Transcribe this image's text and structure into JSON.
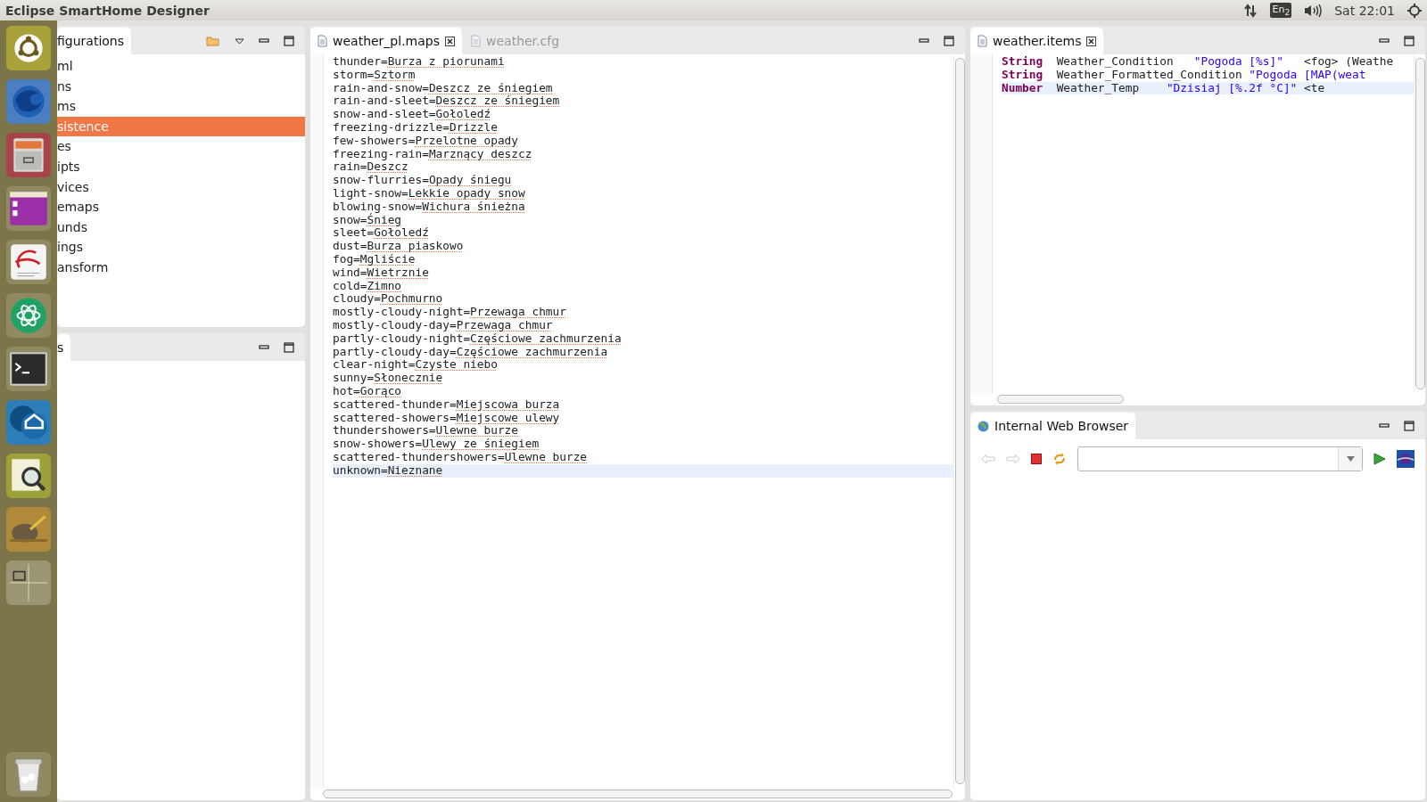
{
  "top_bar": {
    "title": "Eclipse SmartHome Designer",
    "keyboard_layout": "En$_{2}$",
    "clock": "Sat 22:01"
  },
  "launcher": {
    "apps": [
      {
        "kind": "ubuntu"
      },
      {
        "kind": "browser"
      },
      {
        "kind": "files"
      },
      {
        "kind": "purple"
      },
      {
        "kind": "document"
      },
      {
        "kind": "atom"
      },
      {
        "kind": "terminal"
      },
      {
        "kind": "home"
      },
      {
        "kind": "viewer"
      },
      {
        "kind": "paint"
      },
      {
        "kind": "workspaces"
      }
    ],
    "trash": {
      "kind": "trash"
    }
  },
  "explorer": {
    "tab": "figurations",
    "items": [
      {
        "label": "ml",
        "selected": false
      },
      {
        "label": "ns",
        "selected": false
      },
      {
        "label": "ms",
        "selected": false
      },
      {
        "label": "sistence",
        "selected": true
      },
      {
        "label": "es",
        "selected": false
      },
      {
        "label": "ipts",
        "selected": false
      },
      {
        "label": "vices",
        "selected": false
      },
      {
        "label": "emaps",
        "selected": false
      },
      {
        "label": "unds",
        "selected": false
      },
      {
        "label": "ings",
        "selected": false
      },
      {
        "label": "ansform",
        "selected": false
      }
    ]
  },
  "second_panel": {
    "tab": "s"
  },
  "editor": {
    "tabs": [
      {
        "label": "weather_pl.maps",
        "selected": true
      },
      {
        "label": "weather.cfg",
        "selected": false
      }
    ],
    "lines": [
      {
        "text": "thunder=Burza z piorunami",
        "current": false
      },
      {
        "text": "storm=Sztorm",
        "current": false
      },
      {
        "text": "rain-and-snow=Deszcz ze śniegiem",
        "current": false
      },
      {
        "text": "rain-and-sleet=Deszcz ze śniegiem",
        "current": false
      },
      {
        "text": "snow-and-sleet=Gołoledź",
        "current": false
      },
      {
        "text": "freezing-drizzle=Drizzle",
        "current": false
      },
      {
        "text": "few-showers=Przelotne opady",
        "current": false
      },
      {
        "text": "freezing-rain=Marznący deszcz",
        "current": false
      },
      {
        "text": "rain=Deszcz",
        "current": false
      },
      {
        "text": "snow-flurries=Opady śniegu",
        "current": false
      },
      {
        "text": "light-snow=Lekkie opady snow",
        "current": false
      },
      {
        "text": "blowing-snow=Wichura śnieżna",
        "current": false
      },
      {
        "text": "snow=Śnieg",
        "current": false
      },
      {
        "text": "sleet=Gołoledź",
        "current": false
      },
      {
        "text": "dust=Burza piaskowo",
        "current": false
      },
      {
        "text": "fog=Mgliście",
        "current": false
      },
      {
        "text": "wind=Wietrznie",
        "current": false
      },
      {
        "text": "cold=Zimno",
        "current": false
      },
      {
        "text": "cloudy=Pochmurno",
        "current": false
      },
      {
        "text": "mostly-cloudy-night=Przewaga chmur",
        "current": false
      },
      {
        "text": "mostly-cloudy-day=Przewaga chmur",
        "current": false
      },
      {
        "text": "partly-cloudy-night=Częściowe zachmurzenia",
        "current": false
      },
      {
        "text": "partly-cloudy-day=Częściowe zachmurzenia",
        "current": false
      },
      {
        "text": "clear-night=Czyste niebo",
        "current": false
      },
      {
        "text": "sunny=Słonecznie",
        "current": false
      },
      {
        "text": "hot=Gorąco",
        "current": false
      },
      {
        "text": "scattered-thunder=Miejscowa burza",
        "current": false
      },
      {
        "text": "scattered-showers=Miejscowe ulewy",
        "current": false
      },
      {
        "text": "thundershowers=Ulewne burze",
        "current": false
      },
      {
        "text": "snow-showers=Ulewy ze śniegiem",
        "current": false
      },
      {
        "text": "scattered-thundershowers=Ulewne burze",
        "current": false
      },
      {
        "text": "unknown=Nieznane",
        "current": true
      }
    ]
  },
  "items_editor": {
    "tabs": [
      {
        "label": "weather.items",
        "selected": true
      }
    ],
    "lines": [
      {
        "current": false,
        "tokens": [
          {
            "kind": "keyword",
            "text": "String"
          },
          {
            "kind": "plain",
            "text": "Weather_Condition"
          },
          {
            "kind": "label",
            "text": "\"Pogoda [%s]\""
          },
          {
            "kind": "plain",
            "text": "<fog> (Weathe"
          }
        ]
      },
      {
        "current": false,
        "tokens": [
          {
            "kind": "keyword",
            "text": "String"
          },
          {
            "kind": "plain",
            "text": "Weather_Formatted_Condition"
          },
          {
            "kind": "label",
            "text": "\"Pogoda [MAP(weat"
          }
        ]
      },
      {
        "current": true,
        "tokens": [
          {
            "kind": "keyword",
            "text": "Number"
          },
          {
            "kind": "plain",
            "text": "Weather_Temp"
          },
          {
            "kind": "label",
            "text": "\"Dzisiaj [%.2f °C]\""
          },
          {
            "kind": "plain",
            "text": "<te"
          }
        ]
      }
    ]
  },
  "browser": {
    "tab": "Internal Web Browser"
  }
}
